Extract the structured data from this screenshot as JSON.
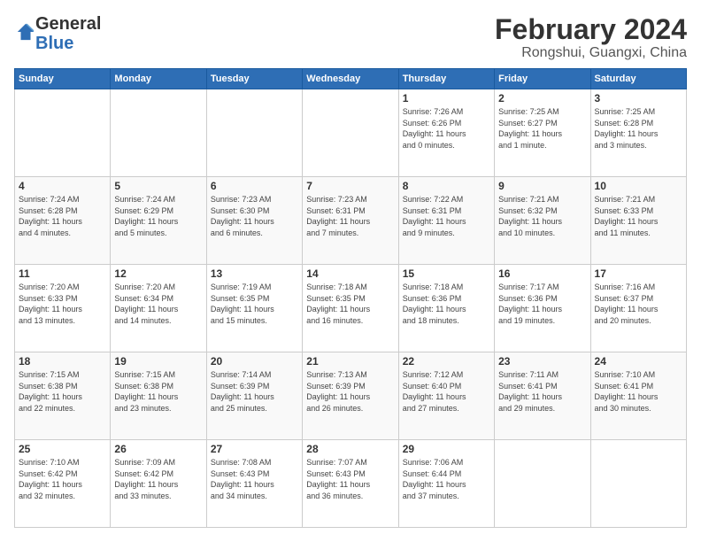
{
  "header": {
    "logo_line1": "General",
    "logo_line2": "Blue",
    "month_year": "February 2024",
    "location": "Rongshui, Guangxi, China"
  },
  "days_of_week": [
    "Sunday",
    "Monday",
    "Tuesday",
    "Wednesday",
    "Thursday",
    "Friday",
    "Saturday"
  ],
  "weeks": [
    [
      {
        "day": "",
        "info": ""
      },
      {
        "day": "",
        "info": ""
      },
      {
        "day": "",
        "info": ""
      },
      {
        "day": "",
        "info": ""
      },
      {
        "day": "1",
        "info": "Sunrise: 7:26 AM\nSunset: 6:26 PM\nDaylight: 11 hours\nand 0 minutes."
      },
      {
        "day": "2",
        "info": "Sunrise: 7:25 AM\nSunset: 6:27 PM\nDaylight: 11 hours\nand 1 minute."
      },
      {
        "day": "3",
        "info": "Sunrise: 7:25 AM\nSunset: 6:28 PM\nDaylight: 11 hours\nand 3 minutes."
      }
    ],
    [
      {
        "day": "4",
        "info": "Sunrise: 7:24 AM\nSunset: 6:28 PM\nDaylight: 11 hours\nand 4 minutes."
      },
      {
        "day": "5",
        "info": "Sunrise: 7:24 AM\nSunset: 6:29 PM\nDaylight: 11 hours\nand 5 minutes."
      },
      {
        "day": "6",
        "info": "Sunrise: 7:23 AM\nSunset: 6:30 PM\nDaylight: 11 hours\nand 6 minutes."
      },
      {
        "day": "7",
        "info": "Sunrise: 7:23 AM\nSunset: 6:31 PM\nDaylight: 11 hours\nand 7 minutes."
      },
      {
        "day": "8",
        "info": "Sunrise: 7:22 AM\nSunset: 6:31 PM\nDaylight: 11 hours\nand 9 minutes."
      },
      {
        "day": "9",
        "info": "Sunrise: 7:21 AM\nSunset: 6:32 PM\nDaylight: 11 hours\nand 10 minutes."
      },
      {
        "day": "10",
        "info": "Sunrise: 7:21 AM\nSunset: 6:33 PM\nDaylight: 11 hours\nand 11 minutes."
      }
    ],
    [
      {
        "day": "11",
        "info": "Sunrise: 7:20 AM\nSunset: 6:33 PM\nDaylight: 11 hours\nand 13 minutes."
      },
      {
        "day": "12",
        "info": "Sunrise: 7:20 AM\nSunset: 6:34 PM\nDaylight: 11 hours\nand 14 minutes."
      },
      {
        "day": "13",
        "info": "Sunrise: 7:19 AM\nSunset: 6:35 PM\nDaylight: 11 hours\nand 15 minutes."
      },
      {
        "day": "14",
        "info": "Sunrise: 7:18 AM\nSunset: 6:35 PM\nDaylight: 11 hours\nand 16 minutes."
      },
      {
        "day": "15",
        "info": "Sunrise: 7:18 AM\nSunset: 6:36 PM\nDaylight: 11 hours\nand 18 minutes."
      },
      {
        "day": "16",
        "info": "Sunrise: 7:17 AM\nSunset: 6:36 PM\nDaylight: 11 hours\nand 19 minutes."
      },
      {
        "day": "17",
        "info": "Sunrise: 7:16 AM\nSunset: 6:37 PM\nDaylight: 11 hours\nand 20 minutes."
      }
    ],
    [
      {
        "day": "18",
        "info": "Sunrise: 7:15 AM\nSunset: 6:38 PM\nDaylight: 11 hours\nand 22 minutes."
      },
      {
        "day": "19",
        "info": "Sunrise: 7:15 AM\nSunset: 6:38 PM\nDaylight: 11 hours\nand 23 minutes."
      },
      {
        "day": "20",
        "info": "Sunrise: 7:14 AM\nSunset: 6:39 PM\nDaylight: 11 hours\nand 25 minutes."
      },
      {
        "day": "21",
        "info": "Sunrise: 7:13 AM\nSunset: 6:39 PM\nDaylight: 11 hours\nand 26 minutes."
      },
      {
        "day": "22",
        "info": "Sunrise: 7:12 AM\nSunset: 6:40 PM\nDaylight: 11 hours\nand 27 minutes."
      },
      {
        "day": "23",
        "info": "Sunrise: 7:11 AM\nSunset: 6:41 PM\nDaylight: 11 hours\nand 29 minutes."
      },
      {
        "day": "24",
        "info": "Sunrise: 7:10 AM\nSunset: 6:41 PM\nDaylight: 11 hours\nand 30 minutes."
      }
    ],
    [
      {
        "day": "25",
        "info": "Sunrise: 7:10 AM\nSunset: 6:42 PM\nDaylight: 11 hours\nand 32 minutes."
      },
      {
        "day": "26",
        "info": "Sunrise: 7:09 AM\nSunset: 6:42 PM\nDaylight: 11 hours\nand 33 minutes."
      },
      {
        "day": "27",
        "info": "Sunrise: 7:08 AM\nSunset: 6:43 PM\nDaylight: 11 hours\nand 34 minutes."
      },
      {
        "day": "28",
        "info": "Sunrise: 7:07 AM\nSunset: 6:43 PM\nDaylight: 11 hours\nand 36 minutes."
      },
      {
        "day": "29",
        "info": "Sunrise: 7:06 AM\nSunset: 6:44 PM\nDaylight: 11 hours\nand 37 minutes."
      },
      {
        "day": "",
        "info": ""
      },
      {
        "day": "",
        "info": ""
      }
    ]
  ]
}
